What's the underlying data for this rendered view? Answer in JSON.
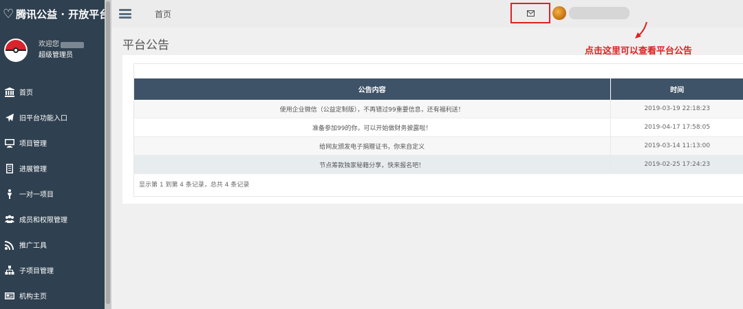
{
  "brand": {
    "logo_text": "腾讯公益 · 开放平台"
  },
  "profile": {
    "welcome": "欢迎您",
    "role": "超级管理员"
  },
  "nav": [
    {
      "label": "首页",
      "icon": "bank-icon"
    },
    {
      "label": "旧平台功能入口",
      "icon": "plane-icon"
    },
    {
      "label": "项目管理",
      "icon": "monitor-icon"
    },
    {
      "label": "进展管理",
      "icon": "document-icon"
    },
    {
      "label": "一对一项目",
      "icon": "person-icon"
    },
    {
      "label": "成员和权限管理",
      "icon": "group-icon"
    },
    {
      "label": "推广工具",
      "icon": "rss-icon"
    },
    {
      "label": "子项目管理",
      "icon": "sitemap-icon"
    },
    {
      "label": "机构主页",
      "icon": "newspaper-icon"
    }
  ],
  "topbar": {
    "breadcrumb": "首页"
  },
  "annotation": "点击这里可以查看平台公告",
  "page": {
    "title": "平台公告"
  },
  "table": {
    "headers": [
      "公告内容",
      "时间"
    ],
    "rows": [
      {
        "content": "使用企业微信（公益定制版），不再错过99重要信息，还有福利送！",
        "time": "2019-03-19 22:18:23"
      },
      {
        "content": "准备参加99的你，可以开始做财务披露啦！",
        "time": "2019-04-17 17:58:05"
      },
      {
        "content": "给网友颁发电子捐赠证书，你来自定义",
        "time": "2019-03-14 11:13:00"
      },
      {
        "content": "节点筹款独家秘籍分享，快来报名吧！",
        "time": "2019-02-25 17:24:23"
      }
    ],
    "footer": "显示第 1 到第 4 条记录，总共 4 条记录"
  },
  "colors": {
    "sidebar": "#2f4050",
    "table_header": "#3f5368",
    "annotation": "#e02020"
  }
}
